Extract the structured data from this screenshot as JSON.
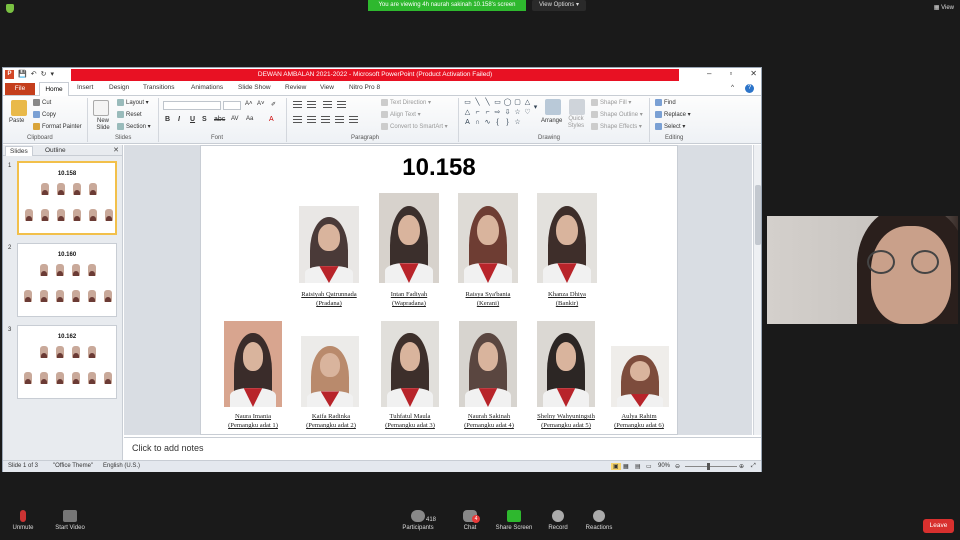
{
  "zoom": {
    "banner": "You are viewing 4h naurah sakinah 10.158's screen",
    "view_options": "View Options",
    "view": "View",
    "toolbar": {
      "unmute": "Unmute",
      "start_video": "Start Video",
      "participants": "Participants",
      "participants_count": "418",
      "chat": "Chat",
      "chat_badge": "4",
      "share_screen": "Share Screen",
      "record": "Record",
      "reactions": "Reactions",
      "leave": "Leave"
    }
  },
  "ppt": {
    "title": "DEWAN AMBALAN 2021-2022  -  Microsoft PowerPoint (Product Activation Failed)",
    "tabs": [
      "File",
      "Home",
      "Insert",
      "Design",
      "Transitions",
      "Animations",
      "Slide Show",
      "Review",
      "View",
      "Nitro Pro 8"
    ],
    "ribbon": {
      "paste": "Paste",
      "cut": "Cut",
      "copy": "Copy",
      "format_painter": "Format Painter",
      "clipboard": "Clipboard",
      "new_slide": "New Slide",
      "layout": "Layout",
      "reset": "Reset",
      "section": "Section",
      "slides": "Slides",
      "font": "Font",
      "text_direction": "Text Direction",
      "align_text": "Align Text",
      "convert_smartart": "Convert to SmartArt",
      "paragraph": "Paragraph",
      "arrange": "Arrange",
      "quick_styles": "Quick Styles",
      "shape_fill": "Shape Fill",
      "shape_outline": "Shape Outline",
      "shape_effects": "Shape Effects",
      "drawing": "Drawing",
      "find": "Find",
      "replace": "Replace",
      "select": "Select",
      "editing": "Editing"
    },
    "panel": {
      "slides_tab": "Slides",
      "outline_tab": "Outline",
      "thumbs": [
        {
          "num": "1",
          "title": "10.158"
        },
        {
          "num": "2",
          "title": "10.160"
        },
        {
          "num": "3",
          "title": "10.162"
        }
      ]
    },
    "slide": {
      "title": "10.158",
      "row1": [
        {
          "name": "Raisiyah Qatrunnada",
          "role": "(Pradana)"
        },
        {
          "name": "Intan Fadiyah",
          "role": "(Wapradana)"
        },
        {
          "name": "Raisya Sya'bania",
          "role": "(Kerani)"
        },
        {
          "name": "Khanza Dhiya",
          "role": "(Bankir)"
        }
      ],
      "row2": [
        {
          "name": "Naura Imania",
          "role": "(Pemangku adat 1)"
        },
        {
          "name": "Kaifa Radinka",
          "role": "(Pemangku adat 2)"
        },
        {
          "name": "Tuhfatul Maula",
          "role": "(Pemangku adat 3)"
        },
        {
          "name": "Naurah Sakinah",
          "role": "(Pemangku adat 4)"
        },
        {
          "name": "Shelny Wahyuningsih",
          "role": "(Pemangku adat 5)"
        },
        {
          "name": "Aulya Rahim",
          "role": "(Pemangku adat 6)"
        }
      ]
    },
    "notes_placeholder": "Click to add notes",
    "status": {
      "slide_of": "Slide 1 of 3",
      "theme": "\"Office Theme\"",
      "language": "English (U.S.)",
      "zoom": "90%"
    },
    "colors": {
      "accent_red": "#e81123",
      "file_tab": "#c43e1c",
      "scarf_red": "#b8242a"
    }
  }
}
